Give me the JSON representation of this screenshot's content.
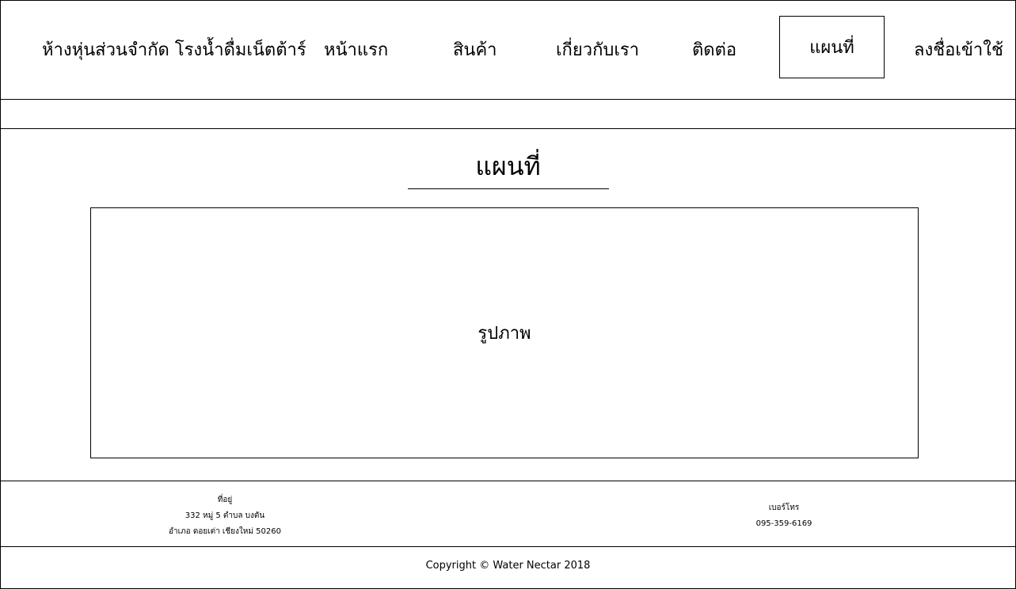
{
  "header": {
    "brand": "ห้างหุ่นส่วนจำกัด โรงน้ำดื่มเน็ตต้าร์",
    "nav": {
      "home": "หน้าแรก",
      "products": "สินค้า",
      "about": "เกี่ยวกับเรา",
      "contact": "ติดต่อ",
      "map": "แผนที่",
      "login": "ลงชื่อเข้าใช้"
    },
    "active_nav": "map"
  },
  "main": {
    "title": "แผนที่",
    "image_placeholder": "รูปภาพ"
  },
  "footer": {
    "address": {
      "label": "ที่อยู่",
      "line1": "332 หมู่ 5 ตำบล บงตัน",
      "line2": "อำเภอ ดอยเต่า เชียงใหม่ 50260"
    },
    "phone": {
      "label": "เบอร์โทร",
      "number": "095-359-6169"
    },
    "copyright": "Copyright © Water Nectar 2018"
  }
}
